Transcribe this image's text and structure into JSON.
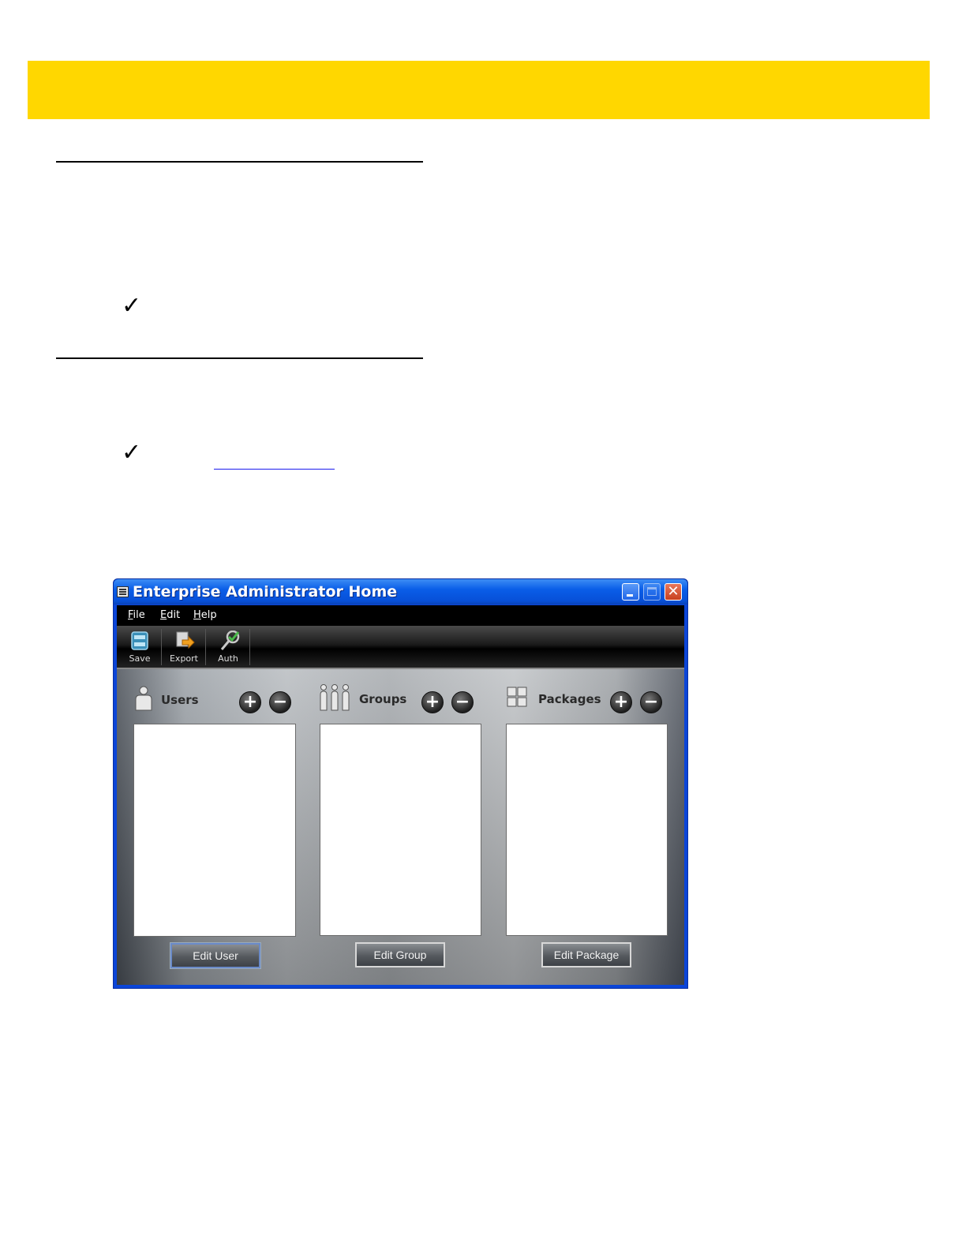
{
  "window": {
    "title": "Enterprise Administrator Home",
    "menu": [
      "File",
      "Edit",
      "Help"
    ],
    "toolbar": [
      {
        "label": "Save",
        "icon": "save-icon"
      },
      {
        "label": "Export",
        "icon": "export-icon"
      },
      {
        "label": "Auth",
        "icon": "auth-icon"
      }
    ],
    "panels": [
      {
        "label": "Users",
        "icon": "user-icon",
        "button": "Edit User"
      },
      {
        "label": "Groups",
        "icon": "group-icon",
        "button": "Edit Group"
      },
      {
        "label": "Packages",
        "icon": "package-icon",
        "button": "Edit Package"
      }
    ],
    "add_glyph": "+",
    "remove_glyph": "−",
    "close_glyph": "✕"
  },
  "doc": {
    "note_glyph": "✓"
  },
  "colors": {
    "banner": "#ffd700",
    "titlebar": "#0a5ee8",
    "link": "#1a1aee"
  }
}
